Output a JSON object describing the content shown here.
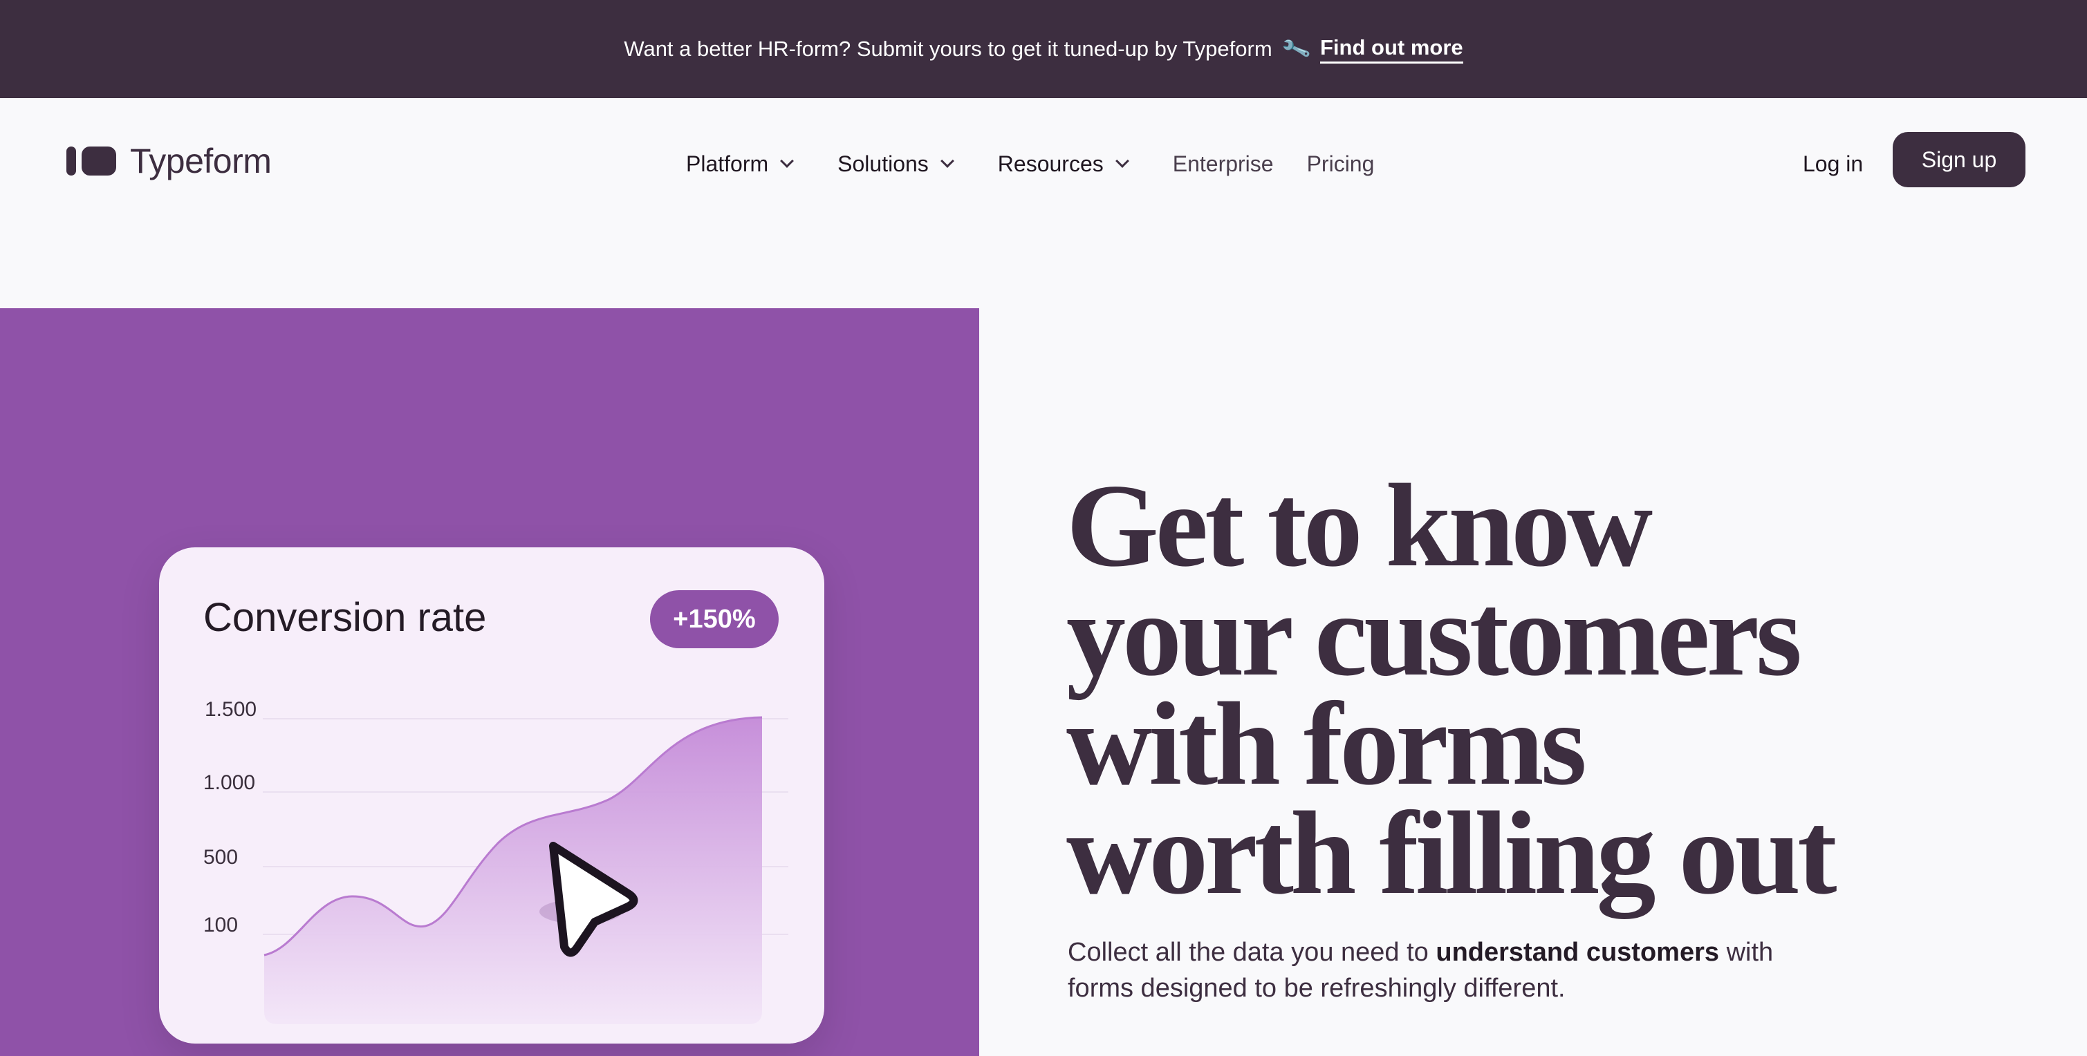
{
  "announcement": {
    "text": "Want a better HR-form? Submit yours to get it tuned-up by Typeform",
    "icon": "wrench-icon",
    "link_label": "Find out more"
  },
  "nav": {
    "brand": "Typeform",
    "items": [
      {
        "label": "Platform",
        "dropdown": true
      },
      {
        "label": "Solutions",
        "dropdown": true
      },
      {
        "label": "Resources",
        "dropdown": true
      },
      {
        "label": "Enterprise",
        "dropdown": false
      },
      {
        "label": "Pricing",
        "dropdown": false
      }
    ],
    "login_label": "Log in",
    "signup_label": "Sign up"
  },
  "colors": {
    "brand_dark": "#3d2e40",
    "hero_purple": "#8f52a8",
    "card_bg": "#f7eefa",
    "page_bg": "#f9f9fb"
  },
  "hero": {
    "headline_lines": [
      "Get to know",
      "your customers",
      "with forms",
      "worth filling out"
    ],
    "subtitle_before": "Collect all the data you need to",
    "subtitle_strong": "understand customers",
    "subtitle_after": "with forms designed to be refreshingly different."
  },
  "card": {
    "title": "Conversion rate",
    "badge": "+150%",
    "cursor_icon": "pointer-cursor-icon"
  },
  "chart_data": {
    "type": "area",
    "title": "Conversion rate",
    "y_ticks": [
      "1.500",
      "1.000",
      "500",
      "100"
    ],
    "y_tick_values": [
      1500,
      1000,
      500,
      100
    ],
    "grid": true
  }
}
